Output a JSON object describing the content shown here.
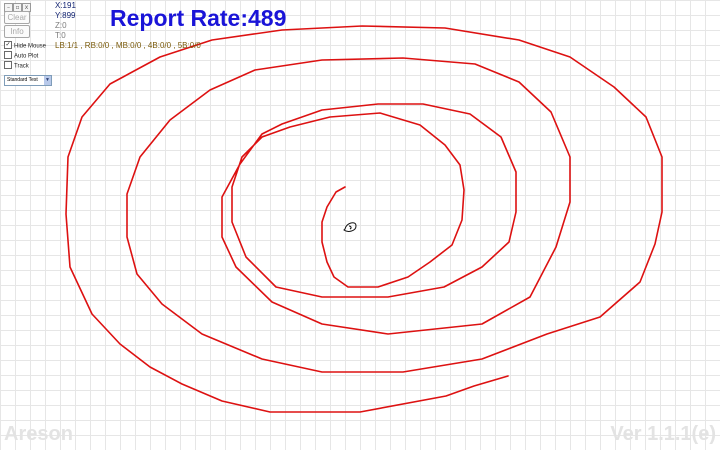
{
  "window_controls": [
    {
      "icon": "minimize-icon",
      "glyph": "–"
    },
    {
      "icon": "restore-icon",
      "glyph": "▫"
    },
    {
      "icon": "close-icon",
      "glyph": "x"
    }
  ],
  "controls": {
    "clear_label": "Clear",
    "info_label": "Info",
    "hide_mouse": {
      "label": "Hide Mouse",
      "checked": true
    },
    "auto_plot": {
      "label": "Auto Plot",
      "checked": false
    },
    "track": {
      "label": "Track",
      "checked": false
    },
    "mode_select": {
      "value": "Standard Test",
      "arrow": "▼"
    }
  },
  "readout": {
    "x": "X:191",
    "y": "Y:899",
    "z": "Z:0",
    "t": "T:0",
    "buttons": "LB:1/1 , RB:0/0 , MB:0/0 , 4B:0/0 , 5B:0/0"
  },
  "report_rate": "Report Rate:489",
  "brand": "Areson",
  "version": "Ver 1.1.1(e)",
  "colors": {
    "trace": "#dd1111",
    "report_rate": "#1a14d8",
    "readout_xy": "#0d1f6e",
    "readout_buttons": "#7a5a0a",
    "watermark": "#e3e3e3"
  }
}
